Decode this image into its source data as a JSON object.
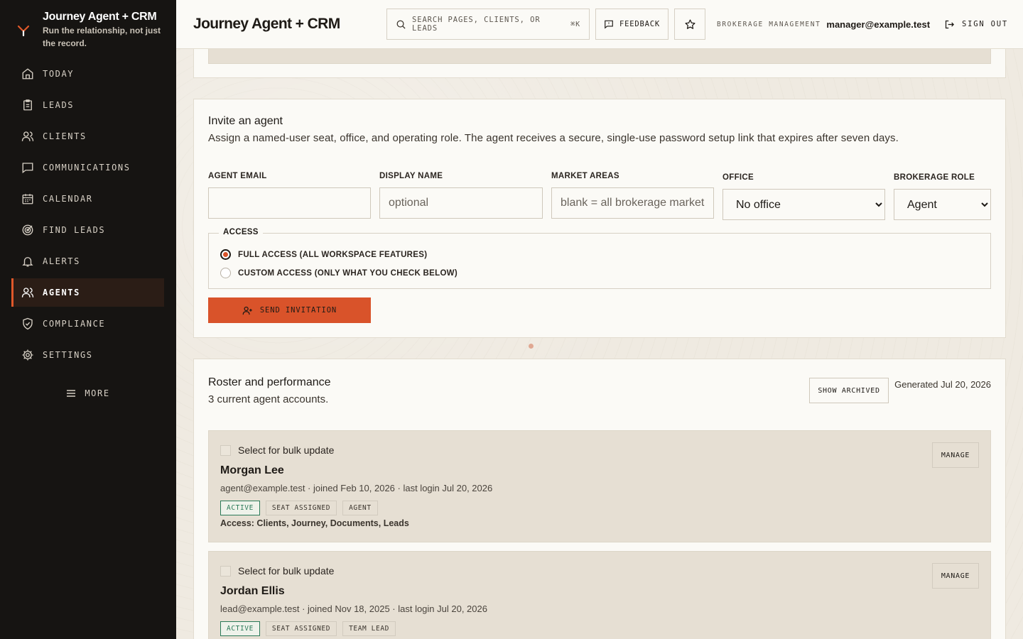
{
  "brand": {
    "title": "Journey Agent + CRM",
    "tagline": "Run the relationship, not just the record."
  },
  "sidebar": {
    "items": [
      {
        "label": "TODAY",
        "icon": "home-icon"
      },
      {
        "label": "LEADS",
        "icon": "clipboard-icon"
      },
      {
        "label": "CLIENTS",
        "icon": "users-icon"
      },
      {
        "label": "COMMUNICATIONS",
        "icon": "message-icon"
      },
      {
        "label": "CALENDAR",
        "icon": "calendar-icon"
      },
      {
        "label": "FIND LEADS",
        "icon": "target-icon"
      },
      {
        "label": "ALERTS",
        "icon": "bell-icon"
      },
      {
        "label": "AGENTS",
        "icon": "users-icon",
        "active": true
      },
      {
        "label": "COMPLIANCE",
        "icon": "shield-check-icon"
      },
      {
        "label": "SETTINGS",
        "icon": "gear-icon"
      }
    ],
    "more_label": "MORE"
  },
  "topbar": {
    "title": "Journey Agent + CRM",
    "search_placeholder": "SEARCH PAGES, CLIENTS, OR LEADS",
    "search_shortcut": "⌘K",
    "feedback_label": "FEEDBACK",
    "org_label": "BROKERAGE MANAGEMENT",
    "user_email": "manager@example.test",
    "signout_label": "SIGN OUT"
  },
  "invite": {
    "title": "Invite an agent",
    "description": "Assign a named-user seat, office, and operating role. The agent receives a secure, single-use password setup link that expires after seven days.",
    "fields": {
      "email_label": "AGENT EMAIL",
      "email_value": "",
      "display_name_label": "DISPLAY NAME",
      "display_name_placeholder": "optional",
      "market_areas_label": "MARKET AREAS",
      "market_areas_placeholder": "blank = all brokerage markets",
      "office_label": "OFFICE",
      "office_value": "No office",
      "role_label": "BROKERAGE ROLE",
      "role_value": "Agent"
    },
    "access": {
      "legend": "ACCESS",
      "full_label": "FULL ACCESS (ALL WORKSPACE FEATURES)",
      "custom_label": "CUSTOM ACCESS (ONLY WHAT YOU CHECK BELOW)",
      "selected": "full"
    },
    "send_label": "SEND INVITATION"
  },
  "roster": {
    "title": "Roster and performance",
    "subtitle": "3 current agent accounts.",
    "show_archived_label": "SHOW ARCHIVED",
    "generated": "Generated Jul 20, 2026",
    "bulk_label": "Select for bulk update",
    "manage_label": "MANAGE",
    "agents": [
      {
        "name": "Morgan Lee",
        "meta": "agent@example.test · joined Feb 10, 2026 · last login Jul 20, 2026",
        "badges": [
          "ACTIVE",
          "SEAT ASSIGNED",
          "AGENT"
        ],
        "access": "Access: Clients, Journey, Documents, Leads"
      },
      {
        "name": "Jordan Ellis",
        "meta": "lead@example.test · joined Nov 18, 2025 · last login Jul 20, 2026",
        "badges": [
          "ACTIVE",
          "SEAT ASSIGNED",
          "TEAM LEAD"
        ],
        "access": ""
      }
    ]
  },
  "colors": {
    "accent": "#d9532a",
    "sidebar_bg": "#161412",
    "active_badge": "#2b7a58"
  }
}
